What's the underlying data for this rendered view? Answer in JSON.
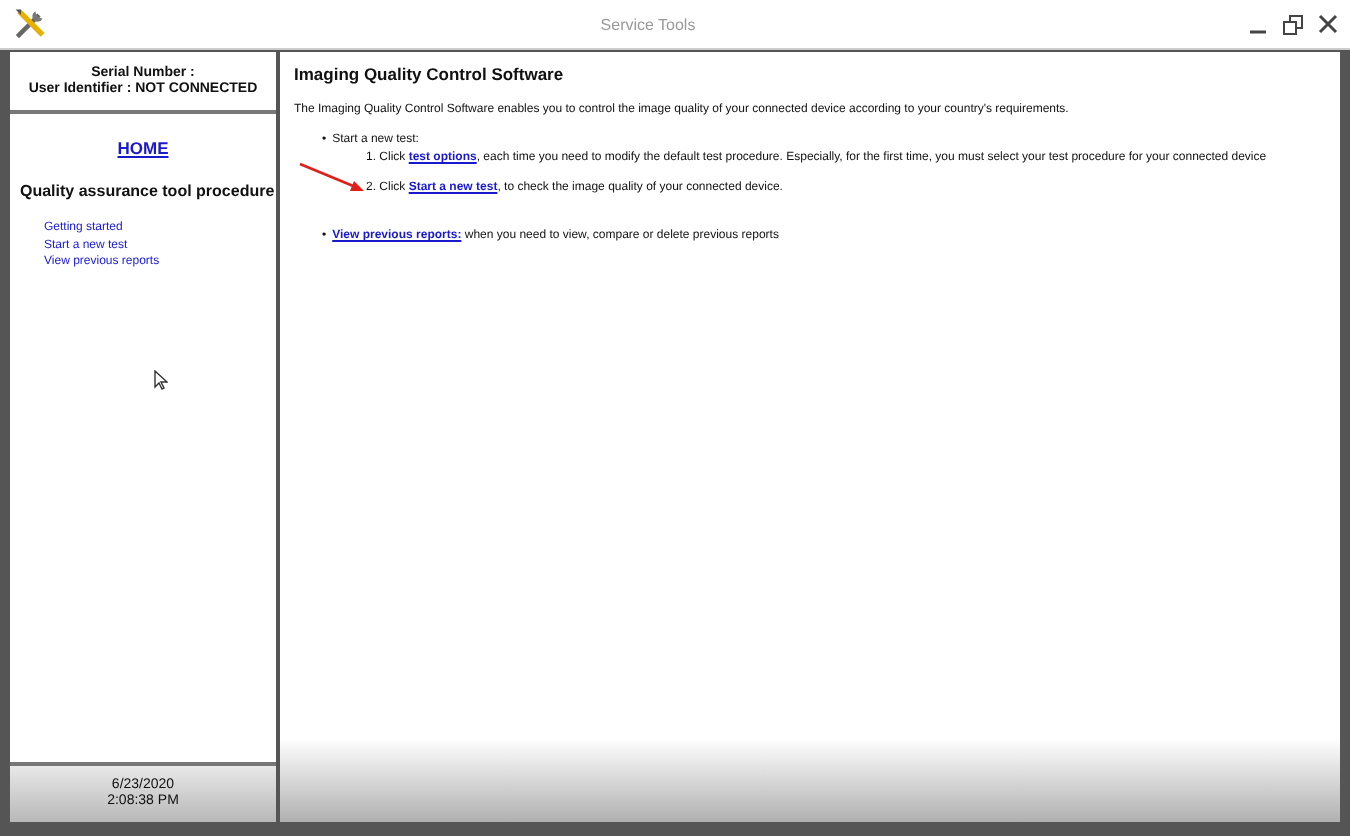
{
  "window": {
    "title": "Service Tools"
  },
  "device_info": {
    "serial_label": "Serial Number :",
    "user_label": "User Identifier :",
    "user_value": "NOT CONNECTED"
  },
  "sidebar": {
    "home_link": "HOME",
    "heading": "Quality assurance tool procedure",
    "items": [
      {
        "label": "Getting started"
      },
      {
        "label": "Start a new test"
      },
      {
        "label": "View previous reports"
      }
    ]
  },
  "status": {
    "date": "6/23/2020",
    "time": "2:08:38 PM"
  },
  "content": {
    "title": "Imaging Quality Control Software",
    "intro": "The Imaging Quality Control Software enables you to control the image quality of your connected device according to your country's requirements.",
    "bullets": [
      {
        "marker": "•",
        "text": "Start a new test:",
        "steps": [
          {
            "number": "1.",
            "before": "Click ",
            "link": "test options",
            "after": ", each time you need to modify the default test procedure. Especially, for the first time, you must select your test procedure for your connected device",
            "annotated": false
          },
          {
            "number": "2.",
            "before": "Click ",
            "link": "Start a new test",
            "after": ", to check the image quality of your connected device.",
            "annotated": true
          }
        ]
      },
      {
        "marker": "•",
        "link": "View previous reports:",
        "after": " when you need to view, compare or delete previous reports"
      }
    ]
  }
}
